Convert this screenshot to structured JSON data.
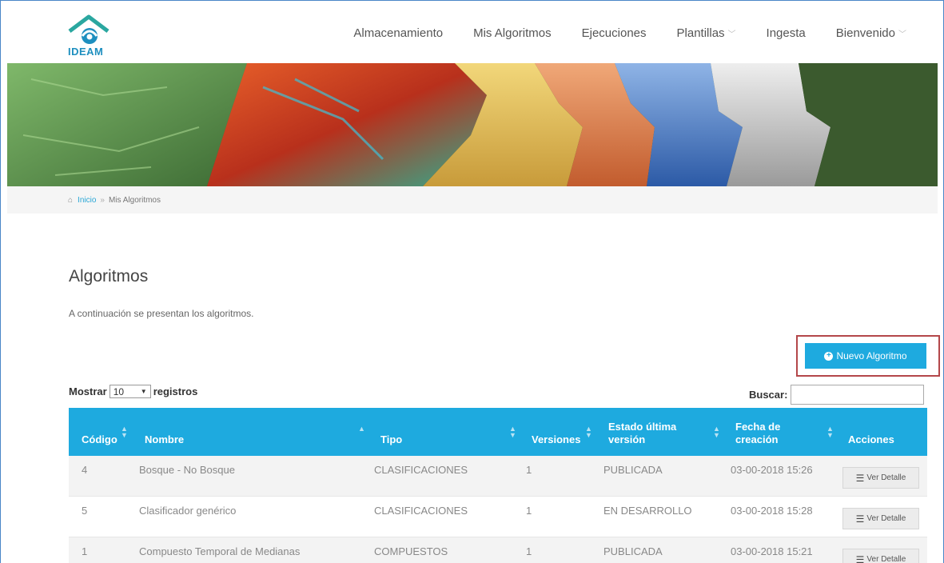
{
  "brand": {
    "logo_text": "IDEAM"
  },
  "nav": {
    "items": [
      {
        "label": "Almacenamiento",
        "dropdown": false
      },
      {
        "label": "Mis Algoritmos",
        "dropdown": false
      },
      {
        "label": "Ejecuciones",
        "dropdown": false
      },
      {
        "label": "Plantillas",
        "dropdown": true
      },
      {
        "label": "Ingesta",
        "dropdown": false
      },
      {
        "label": "Bienvenido",
        "dropdown": true
      }
    ]
  },
  "breadcrumb": {
    "home": "Inicio",
    "separator": "»",
    "current": "Mis Algoritmos"
  },
  "page": {
    "title": "Algoritmos",
    "description": "A continuación se presentan los algoritmos.",
    "new_button": "Nuevo Algoritmo"
  },
  "table_controls": {
    "show_label": "Mostrar",
    "length_value": "10",
    "records_label": "registros",
    "search_label": "Buscar:"
  },
  "table": {
    "headers": [
      "Código",
      "Nombre",
      "Tipo",
      "Versiones",
      "Estado última versión",
      "Fecha de creación",
      "Acciones"
    ],
    "header_lines": {
      "estado_1": "Estado última",
      "estado_2": "versión",
      "fecha_1": "Fecha de",
      "fecha_2": "creación"
    },
    "rows": [
      {
        "codigo": "4",
        "nombre": "Bosque - No Bosque",
        "tipo": "CLASIFICACIONES",
        "versiones": "1",
        "estado": "PUBLICADA",
        "fecha": "03-00-2018 15:26",
        "accion": "Ver Detalle"
      },
      {
        "codigo": "5",
        "nombre": "Clasificador genérico",
        "tipo": "CLASIFICACIONES",
        "versiones": "1",
        "estado": "EN DESARROLLO",
        "fecha": "03-00-2018 15:28",
        "accion": "Ver Detalle"
      },
      {
        "codigo": "1",
        "nombre": "Compuesto Temporal de Medianas",
        "tipo": "COMPUESTOS",
        "versiones": "1",
        "estado": "PUBLICADA",
        "fecha": "03-00-2018 15:21",
        "accion": "Ver Detalle"
      }
    ]
  },
  "colors": {
    "accent": "#1eaadf",
    "highlight_border": "#b4474a",
    "breadcrumb_bg": "#f5f5f5"
  }
}
